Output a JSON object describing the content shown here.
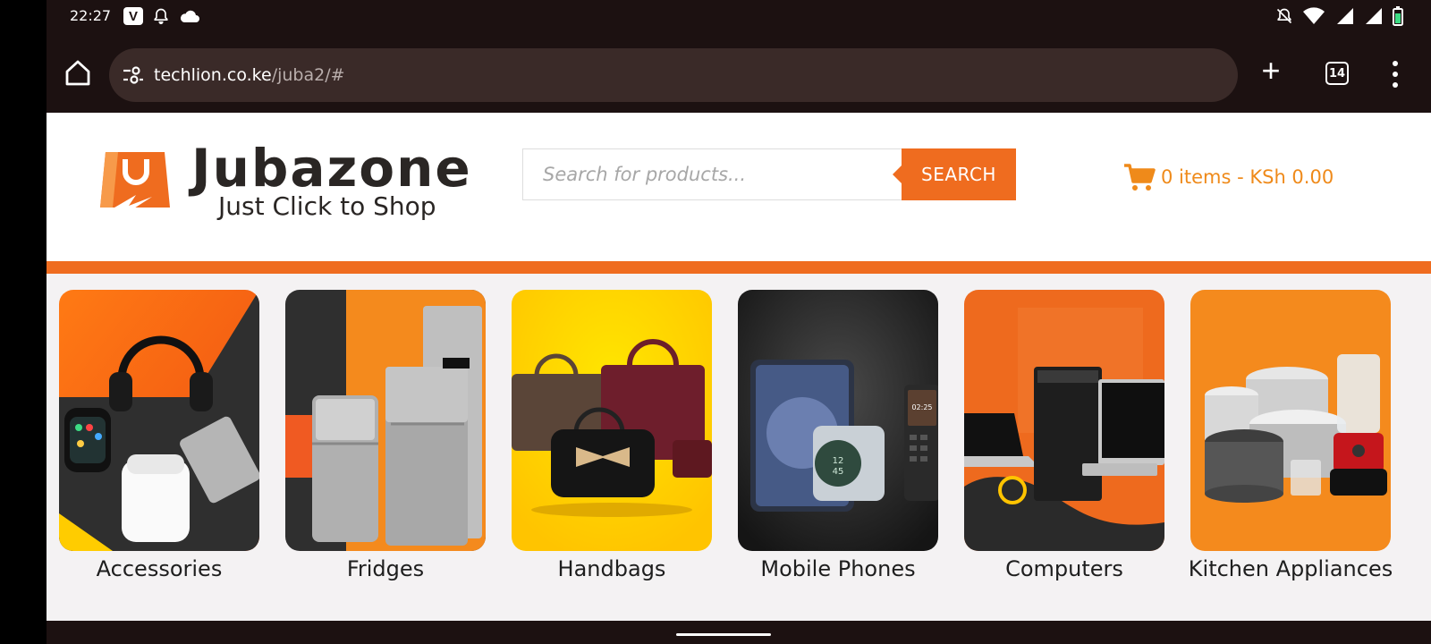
{
  "status_bar": {
    "time": "22:27",
    "app_badge": "V"
  },
  "browser": {
    "url_host": "techlion.co.ke",
    "url_path": "/juba2/#",
    "tab_count": "14"
  },
  "site": {
    "logo_name": "Jubazone",
    "logo_tagline": "Just Click to Shop",
    "search_placeholder": "Search for products...",
    "search_button": "SEARCH",
    "cart_text": "0 items - KSh 0.00",
    "colors": {
      "accent": "#ef6c1f",
      "cart": "#ef8a1a",
      "dark": "#2a2624"
    }
  },
  "categories": [
    {
      "label": "Accessories",
      "icon": "headphones-watch-ssd"
    },
    {
      "label": "Fridges",
      "icon": "refrigerator"
    },
    {
      "label": "Handbags",
      "icon": "handbags"
    },
    {
      "label": "Mobile Phones",
      "icon": "foldable-phones"
    },
    {
      "label": "Computers",
      "icon": "laptop-desktop"
    },
    {
      "label": "Kitchen Appliances",
      "icon": "pots-blender"
    }
  ]
}
